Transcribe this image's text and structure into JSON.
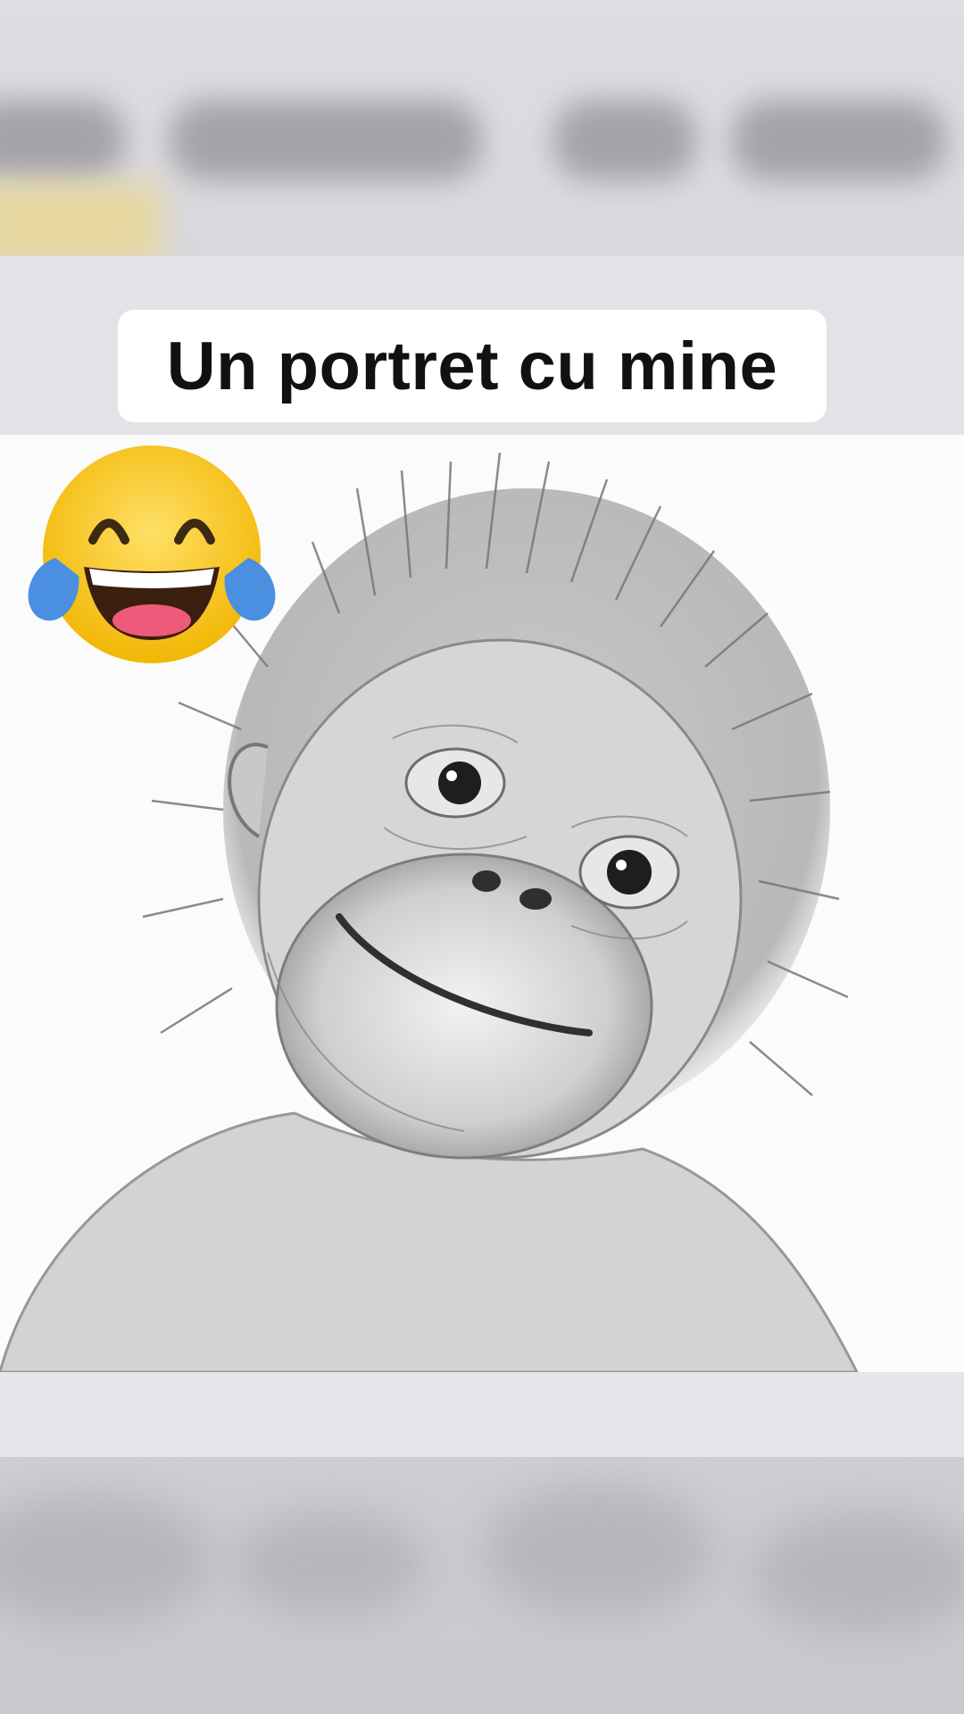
{
  "caption": {
    "text": "Un portret cu mine"
  },
  "emoji": {
    "icon": "face-with-tears-of-joy-icon"
  },
  "illustration": {
    "icon": "pencil-sketch-baby-orangutan"
  },
  "colors": {
    "caption_text": "#111111",
    "caption_background": "#ffffff",
    "emoji_face": "#f6c21c",
    "emoji_tears": "#4a8fe0",
    "sketch_stroke": "#6a6a6a"
  }
}
